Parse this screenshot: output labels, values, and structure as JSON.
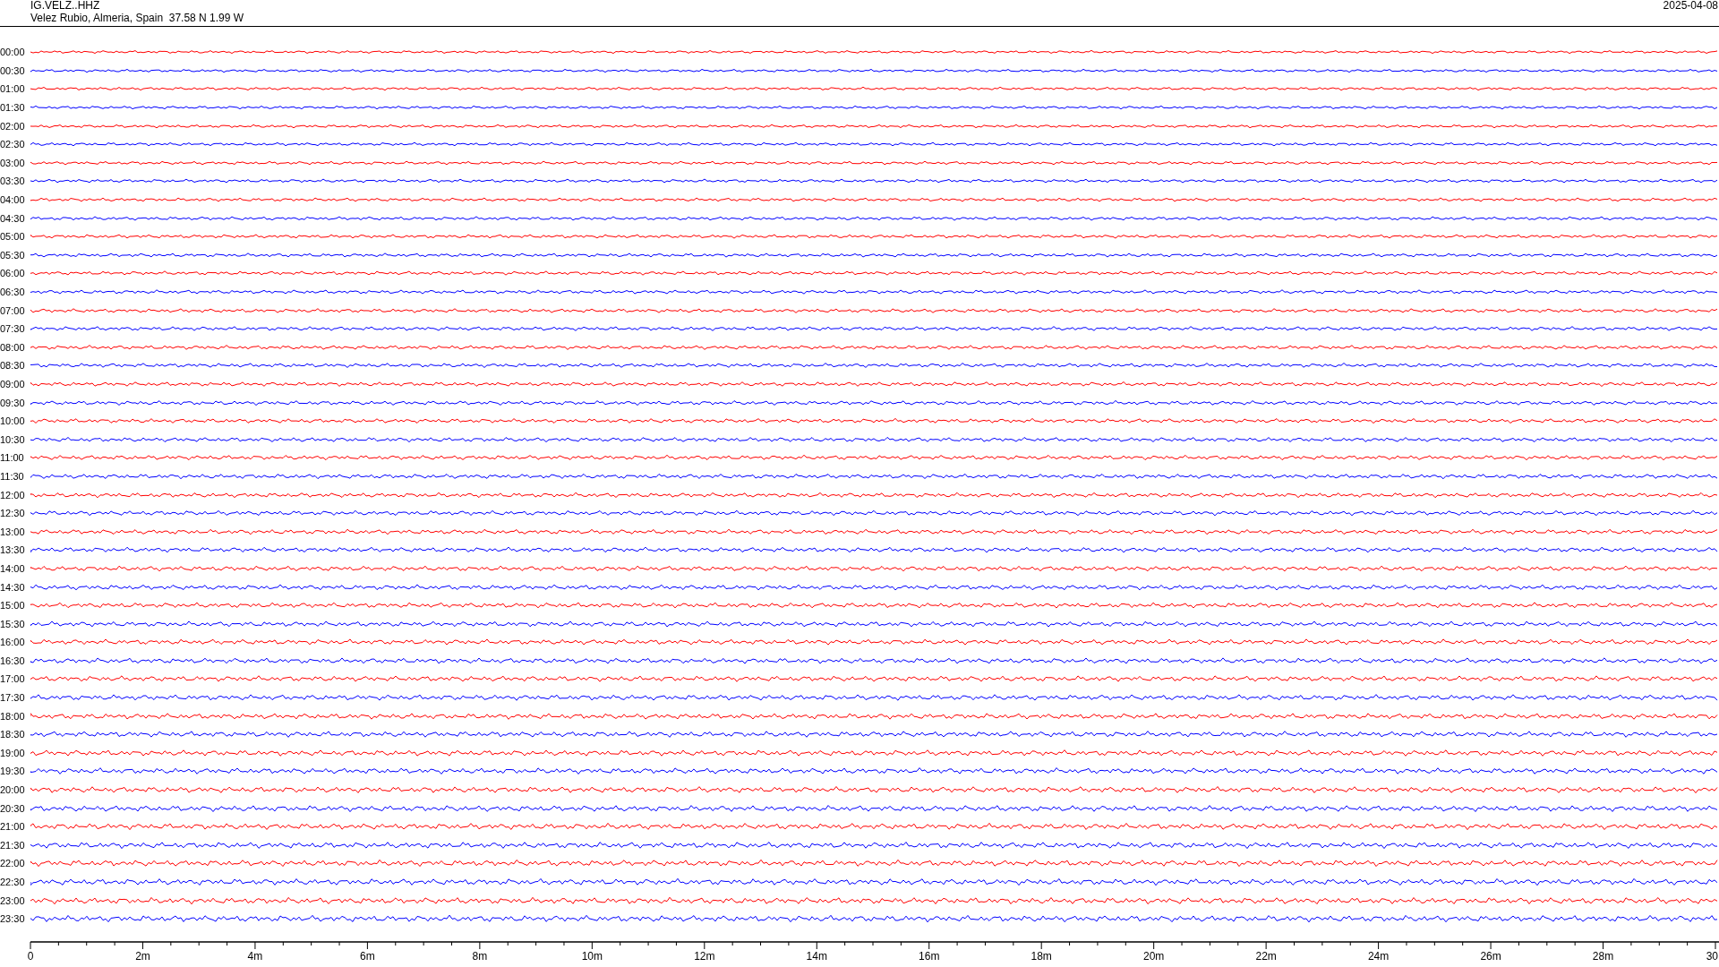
{
  "header": {
    "station": "IG.VELZ..HHZ",
    "location": "Velez Rubio, Almeria, Spain  37.58 N 1.99 W",
    "date": "2025-04-08"
  },
  "traces": [
    {
      "time": "00:00",
      "color": "#ff0000"
    },
    {
      "time": "00:30",
      "color": "#0000ff"
    },
    {
      "time": "01:00",
      "color": "#ff0000"
    },
    {
      "time": "01:30",
      "color": "#0000ff"
    },
    {
      "time": "02:00",
      "color": "#ff0000"
    },
    {
      "time": "02:30",
      "color": "#0000ff"
    },
    {
      "time": "03:00",
      "color": "#ff0000"
    },
    {
      "time": "03:30",
      "color": "#0000ff"
    },
    {
      "time": "04:00",
      "color": "#ff0000"
    },
    {
      "time": "04:30",
      "color": "#0000ff"
    },
    {
      "time": "05:00",
      "color": "#ff0000"
    },
    {
      "time": "05:30",
      "color": "#0000ff"
    },
    {
      "time": "06:00",
      "color": "#ff0000"
    },
    {
      "time": "06:30",
      "color": "#0000ff"
    },
    {
      "time": "07:00",
      "color": "#ff0000"
    },
    {
      "time": "07:30",
      "color": "#0000ff"
    },
    {
      "time": "08:00",
      "color": "#ff0000"
    },
    {
      "time": "08:30",
      "color": "#0000ff"
    },
    {
      "time": "09:00",
      "color": "#ff0000"
    },
    {
      "time": "09:30",
      "color": "#0000ff"
    },
    {
      "time": "10:00",
      "color": "#ff0000"
    },
    {
      "time": "10:30",
      "color": "#0000ff"
    },
    {
      "time": "11:00",
      "color": "#ff0000"
    },
    {
      "time": "11:30",
      "color": "#0000ff"
    },
    {
      "time": "12:00",
      "color": "#ff0000"
    },
    {
      "time": "12:30",
      "color": "#0000ff"
    },
    {
      "time": "13:00",
      "color": "#ff0000"
    },
    {
      "time": "13:30",
      "color": "#0000ff"
    },
    {
      "time": "14:00",
      "color": "#ff0000"
    },
    {
      "time": "14:30",
      "color": "#0000ff"
    },
    {
      "time": "15:00",
      "color": "#ff0000"
    },
    {
      "time": "15:30",
      "color": "#0000ff"
    },
    {
      "time": "16:00",
      "color": "#ff0000"
    },
    {
      "time": "16:30",
      "color": "#0000ff"
    },
    {
      "time": "17:00",
      "color": "#ff0000"
    },
    {
      "time": "17:30",
      "color": "#0000ff"
    },
    {
      "time": "18:00",
      "color": "#ff0000"
    },
    {
      "time": "18:30",
      "color": "#0000ff"
    },
    {
      "time": "19:00",
      "color": "#ff0000"
    },
    {
      "time": "19:30",
      "color": "#0000ff"
    },
    {
      "time": "20:00",
      "color": "#ff0000"
    },
    {
      "time": "20:30",
      "color": "#0000ff"
    },
    {
      "time": "21:00",
      "color": "#ff0000"
    },
    {
      "time": "21:30",
      "color": "#0000ff"
    },
    {
      "time": "22:00",
      "color": "#ff0000"
    },
    {
      "time": "22:30",
      "color": "#0000ff"
    },
    {
      "time": "23:00",
      "color": "#ff0000"
    },
    {
      "time": "23:30",
      "color": "#0000ff"
    }
  ],
  "axis_labels": [
    "0",
    "2m",
    "4m",
    "6m",
    "8m",
    "10m",
    "12m",
    "14m",
    "16m",
    "18m",
    "20m",
    "22m",
    "24m",
    "26m",
    "28m",
    "30"
  ]
}
